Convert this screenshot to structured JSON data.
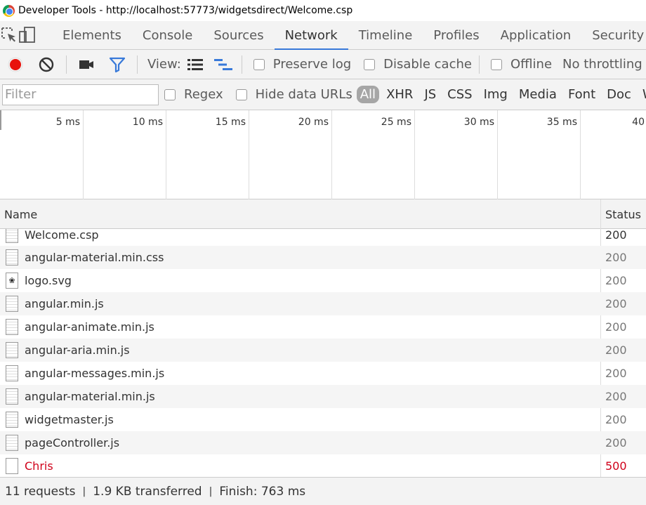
{
  "window": {
    "title": "Developer Tools - http://localhost:57773/widgetsdirect/Welcome.csp"
  },
  "tabs": [
    {
      "label": "Elements"
    },
    {
      "label": "Console"
    },
    {
      "label": "Sources"
    },
    {
      "label": "Network",
      "active": true
    },
    {
      "label": "Timeline"
    },
    {
      "label": "Profiles"
    },
    {
      "label": "Application"
    },
    {
      "label": "Security"
    }
  ],
  "toolbar": {
    "view_label": "View:",
    "preserve_log_label": "Preserve log",
    "disable_cache_label": "Disable cache",
    "offline_label": "Offline",
    "throttling_label": "No throttling",
    "record_color": "#e8120c",
    "filter_active_color": "#3879d9"
  },
  "filterbar": {
    "placeholder": "Filter",
    "regex_label": "Regex",
    "hide_data_urls_label": "Hide data URLs",
    "types": [
      "All",
      "XHR",
      "JS",
      "CSS",
      "Img",
      "Media",
      "Font",
      "Doc",
      "WS"
    ],
    "active_type": "All"
  },
  "timeline": {
    "ticks": [
      "5 ms",
      "10 ms",
      "15 ms",
      "20 ms",
      "25 ms",
      "30 ms",
      "35 ms",
      "40"
    ]
  },
  "columns": {
    "name": "Name",
    "status": "Status"
  },
  "requests": [
    {
      "name": "Welcome.csp",
      "status": "200",
      "icon": "document-icon"
    },
    {
      "name": "angular-material.min.css",
      "status": "200",
      "icon": "document-icon"
    },
    {
      "name": "logo.svg",
      "status": "200",
      "icon": "svg-image-icon"
    },
    {
      "name": "angular.min.js",
      "status": "200",
      "icon": "document-icon"
    },
    {
      "name": "angular-animate.min.js",
      "status": "200",
      "icon": "document-icon"
    },
    {
      "name": "angular-aria.min.js",
      "status": "200",
      "icon": "document-icon"
    },
    {
      "name": "angular-messages.min.js",
      "status": "200",
      "icon": "document-icon"
    },
    {
      "name": "angular-material.min.js",
      "status": "200",
      "icon": "document-icon"
    },
    {
      "name": "widgetmaster.js",
      "status": "200",
      "icon": "document-icon"
    },
    {
      "name": "pageController.js",
      "status": "200",
      "icon": "document-icon"
    },
    {
      "name": "Chris",
      "status": "500",
      "icon": "blank-file-icon",
      "error": true
    }
  ],
  "summary": {
    "requests": "11 requests",
    "transferred": "1.9 KB transferred",
    "finish": "Finish: 763 ms",
    "separator": "|"
  }
}
